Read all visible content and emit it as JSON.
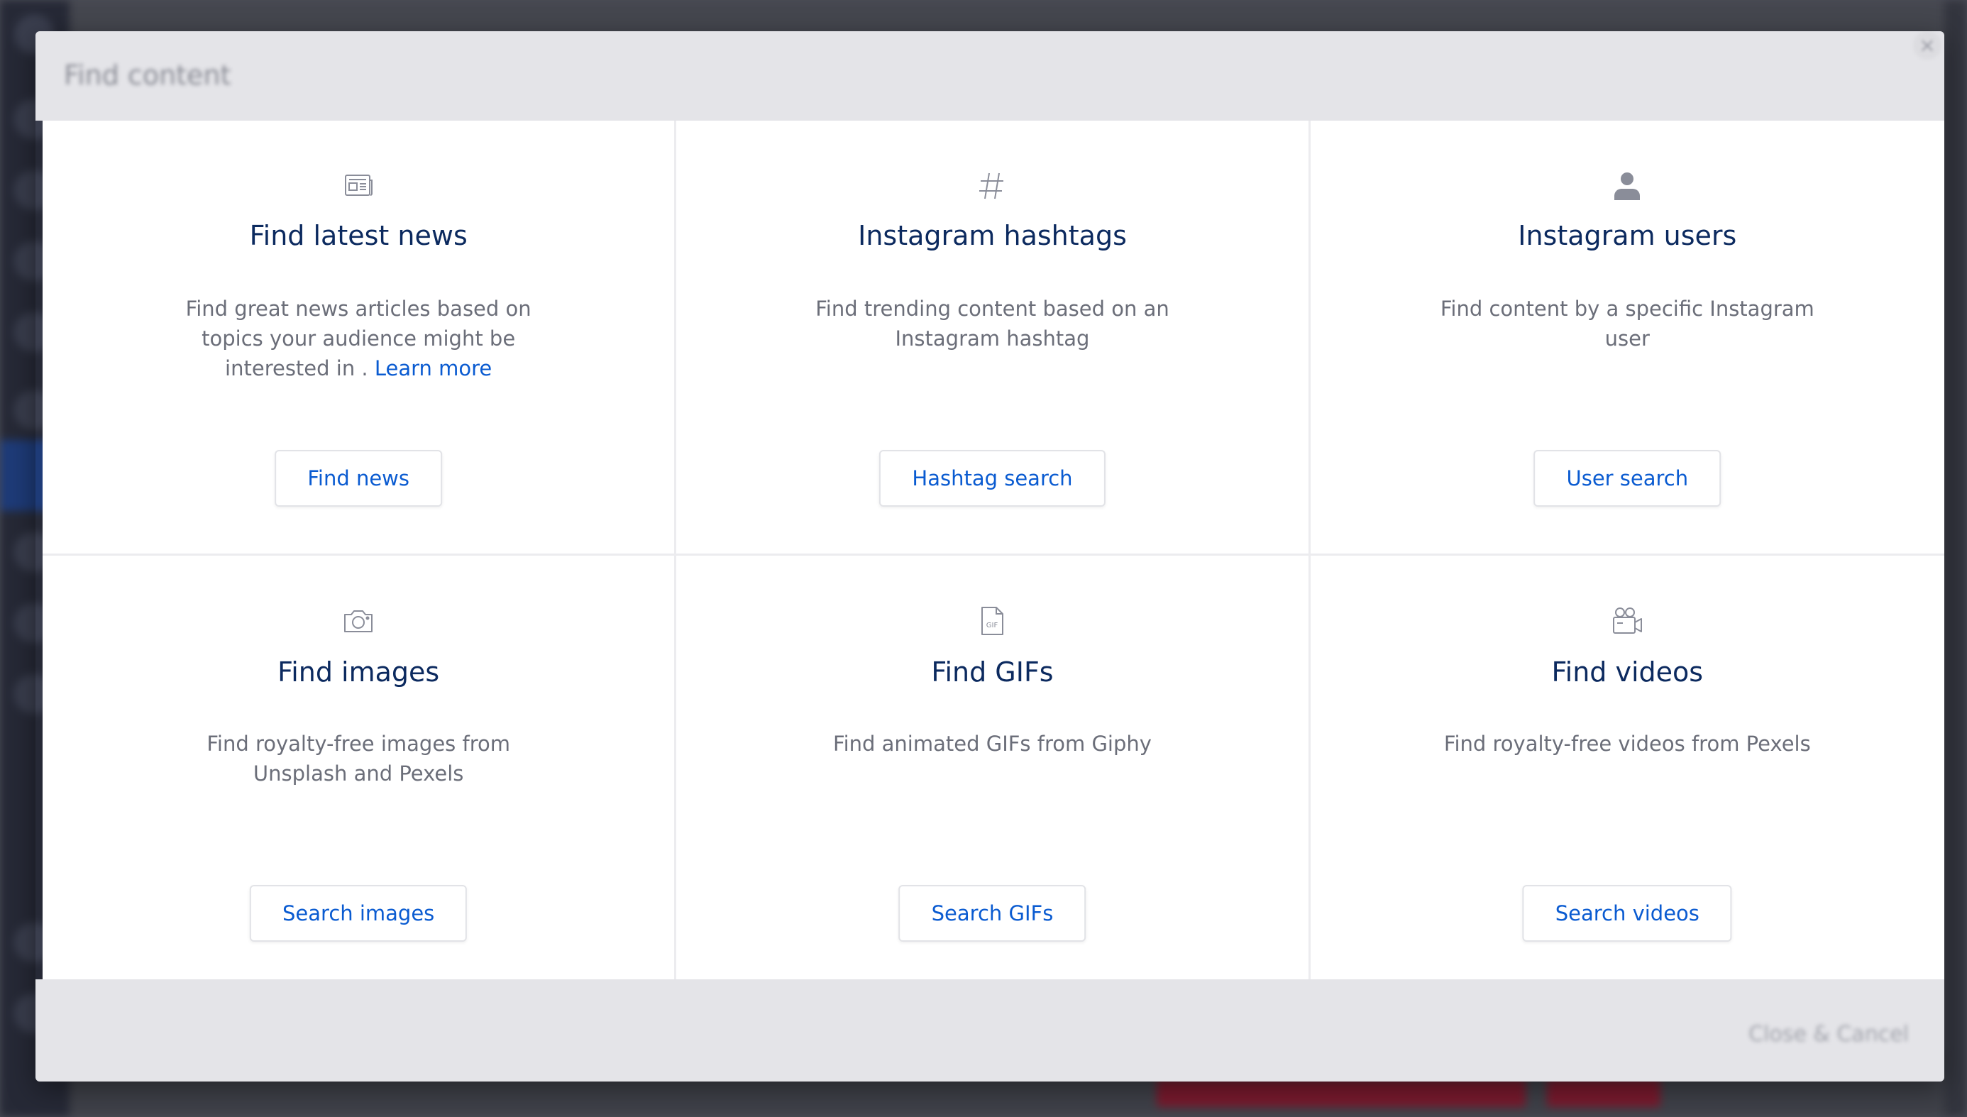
{
  "modal": {
    "title": "Find content",
    "close_glyph": "×",
    "footer_cancel": "Close & Cancel"
  },
  "cards": [
    {
      "icon": "newspaper-icon",
      "title": "Find latest news",
      "description": "Find great news articles based on topics your audience might be interested in .",
      "link_text": "Learn more",
      "button": "Find news"
    },
    {
      "icon": "hashtag-icon",
      "title": "Instagram hashtags",
      "description": "Find trending content based on an Instagram hashtag",
      "button": "Hashtag search"
    },
    {
      "icon": "user-icon",
      "title": "Instagram users",
      "description": "Find content by a specific Instagram user",
      "button": "User search"
    },
    {
      "icon": "camera-icon",
      "title": "Find images",
      "description": "Find royalty-free images from Unsplash and Pexels",
      "button": "Search images"
    },
    {
      "icon": "gif-file-icon",
      "title": "Find GIFs",
      "description": "Find animated GIFs from Giphy",
      "button": "Search GIFs"
    },
    {
      "icon": "video-camera-icon",
      "title": "Find videos",
      "description": "Find royalty-free videos from Pexels",
      "button": "Search videos"
    }
  ],
  "colors": {
    "title": "#0c2a5f",
    "text": "#6b6e79",
    "link": "#0a5bd1",
    "icon": "#8a8d99"
  }
}
